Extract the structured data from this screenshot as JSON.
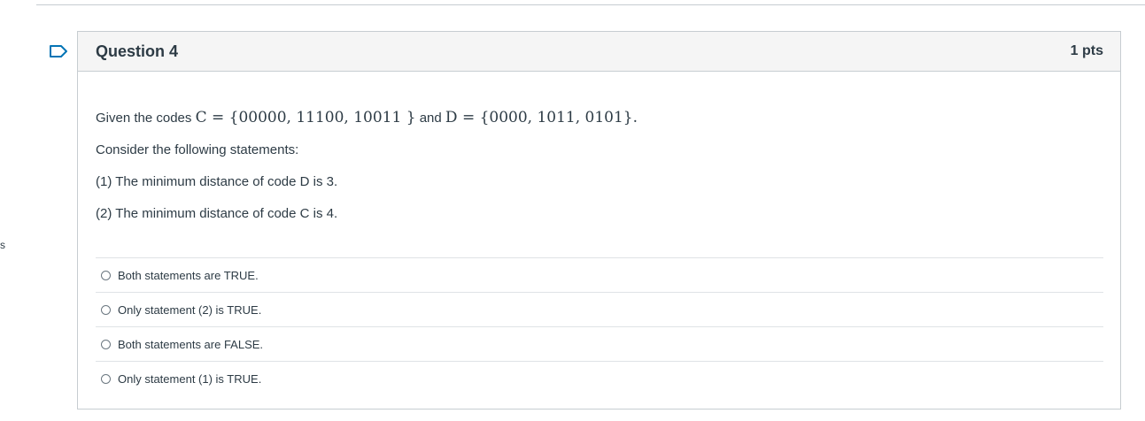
{
  "edge_mark": "s",
  "question": {
    "title": "Question 4",
    "points": "1 pts",
    "given_prefix": "Given the codes ",
    "code_c_math": "C = {00000,  11100, 10011 }",
    "given_mid": " and ",
    "code_d_math": "D = {0000, 1011, 0101}",
    "given_suffix": ".",
    "consider": "Consider the following statements:",
    "statement_1": "(1) The minimum distance of code D is 3.",
    "statement_2": "(2) The minimum distance of code C is 4."
  },
  "answers": [
    {
      "label": "Both statements are TRUE."
    },
    {
      "label": "Only statement (2) is TRUE."
    },
    {
      "label": "Both statements are FALSE."
    },
    {
      "label": "Only statement (1) is TRUE."
    }
  ],
  "colors": {
    "text": "#2d3b45",
    "border": "#c7cdd1",
    "header_bg": "#f5f5f5",
    "flag": "#0374b5"
  },
  "icons": {
    "flag": "bookmark-flag-icon",
    "radio": "radio-button-icon"
  }
}
